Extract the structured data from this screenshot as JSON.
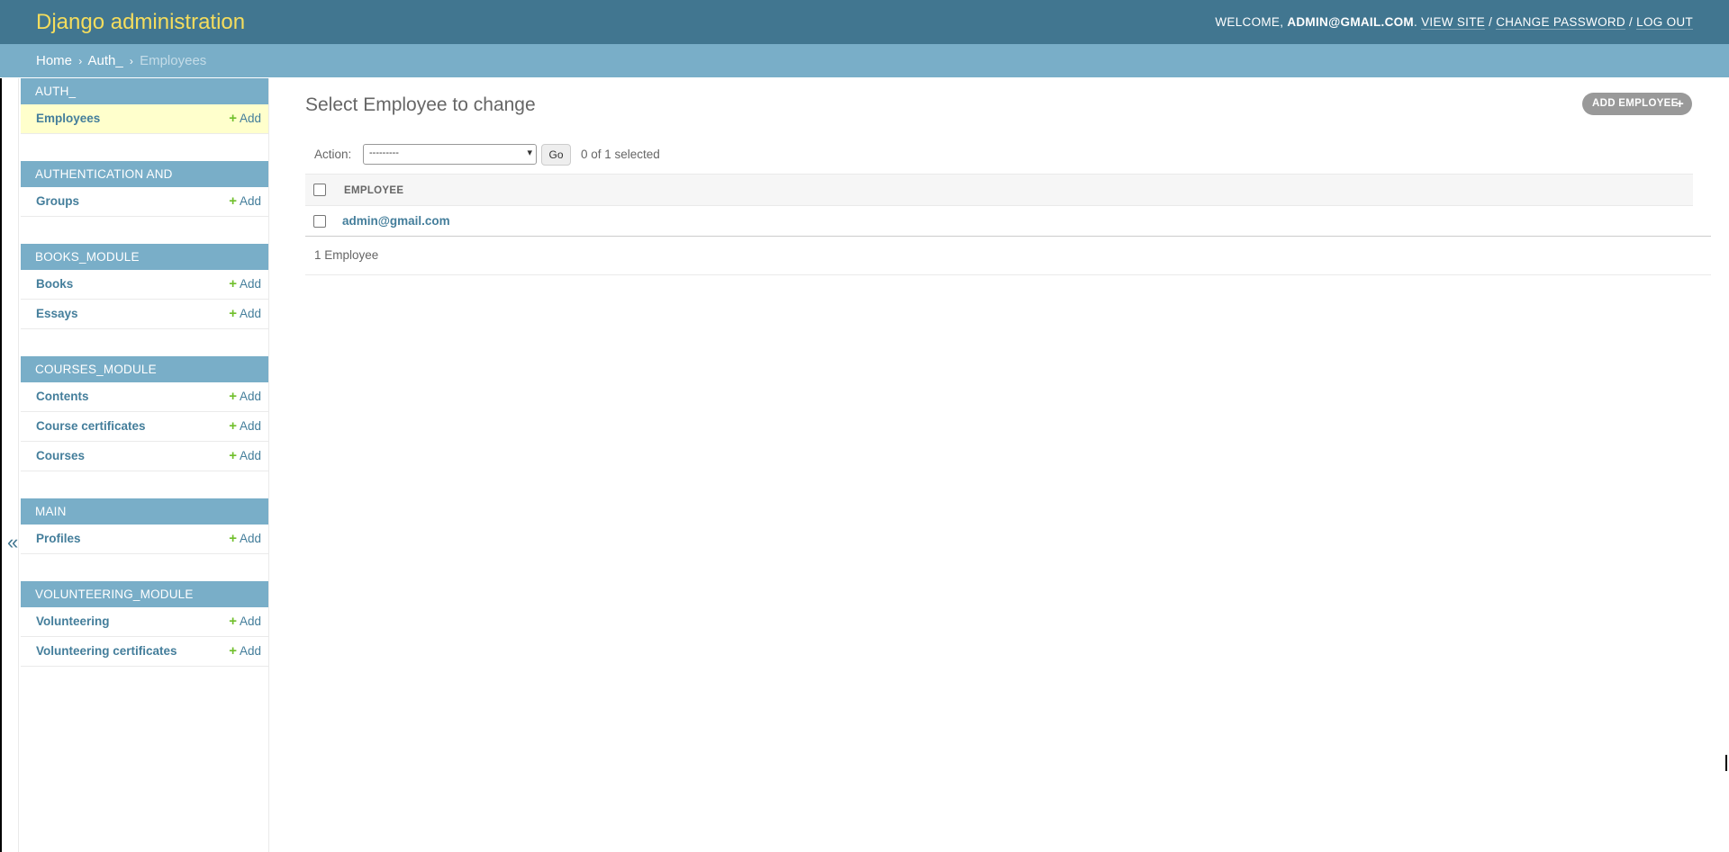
{
  "header": {
    "site_name": "Django administration",
    "welcome": "Welcome, ",
    "username": "admin@gmail.com",
    "view_site": "View site",
    "change_password": "Change password",
    "log_out": "Log out",
    "separator": " / ",
    "colors": {
      "header_bg": "#417690",
      "site_name": "#f5dd5d"
    }
  },
  "breadcrumbs": {
    "home": "Home",
    "app": "Auth_",
    "current": "Employees",
    "separator": "›"
  },
  "sidebar": {
    "toggle_icon": "«",
    "modules": [
      {
        "caption": "AUTH_",
        "models": [
          {
            "name": "Employees",
            "add": "Add",
            "current": true
          }
        ]
      },
      {
        "caption": "AUTHENTICATION AND AUTHORIZATION",
        "models": [
          {
            "name": "Groups",
            "add": "Add"
          }
        ]
      },
      {
        "caption": "BOOKS_MODULE",
        "models": [
          {
            "name": "Books",
            "add": "Add"
          },
          {
            "name": "Essays",
            "add": "Add"
          }
        ]
      },
      {
        "caption": "COURSES_MODULE",
        "models": [
          {
            "name": "Contents",
            "add": "Add"
          },
          {
            "name": "Course certificates",
            "add": "Add"
          },
          {
            "name": "Courses",
            "add": "Add"
          }
        ]
      },
      {
        "caption": "MAIN",
        "models": [
          {
            "name": "Profiles",
            "add": "Add"
          }
        ]
      },
      {
        "caption": "VOLUNTEERING_MODULE",
        "models": [
          {
            "name": "Volunteering",
            "add": "Add"
          },
          {
            "name": "Volunteering certificates",
            "add": "Add"
          }
        ]
      }
    ],
    "colors": {
      "caption_bg": "#79aec8",
      "current_row": "#ffffcc",
      "add_plus": "#70bf2b"
    }
  },
  "content": {
    "title": "Select Employee to change",
    "add_button": "ADD EMPLOYEE",
    "add_icon": "+",
    "actions": {
      "label": "Action:",
      "selected_option": "---------",
      "go": "Go",
      "counter": "0 of 1 selected"
    },
    "table": {
      "column": "EMPLOYEE",
      "rows": [
        "admin@gmail.com"
      ]
    },
    "paginator": "1 Employee"
  }
}
